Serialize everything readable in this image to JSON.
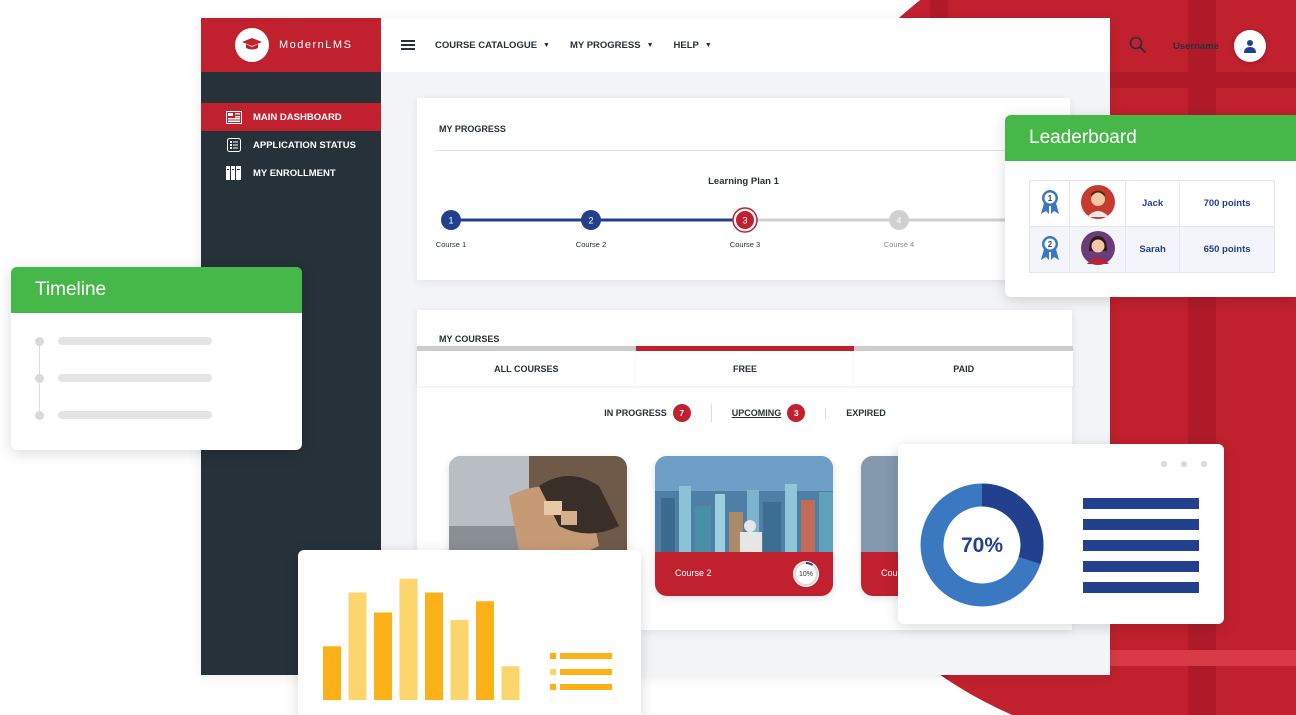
{
  "brand": {
    "name": "ModernLMS"
  },
  "sidebar": {
    "items": [
      {
        "label": "MAIN DASHBOARD",
        "icon": "dashboard-icon",
        "active": true
      },
      {
        "label": "APPLICATION STATUS",
        "icon": "checklist-icon",
        "active": false
      },
      {
        "label": "MY ENROLLMENT",
        "icon": "books-icon",
        "active": false
      }
    ]
  },
  "topbar": {
    "menu": [
      {
        "label": "COURSE CATALOGUE"
      },
      {
        "label": "MY PROGRESS"
      },
      {
        "label": "HELP"
      }
    ],
    "username": "Username"
  },
  "progress": {
    "title": "MY PROGRESS",
    "plan": "Learning Plan 1",
    "steps": [
      {
        "num": "1",
        "label": "Course 1",
        "state": "done"
      },
      {
        "num": "2",
        "label": "Course 2",
        "state": "done"
      },
      {
        "num": "3",
        "label": "Course 3",
        "state": "current"
      },
      {
        "num": "4",
        "label": "Course 4",
        "state": "pending"
      }
    ]
  },
  "courses": {
    "title": "MY COURSES",
    "tabs": [
      {
        "label": "ALL COURSES",
        "active": false
      },
      {
        "label": "FREE",
        "active": true
      },
      {
        "label": "PAID",
        "active": false
      }
    ],
    "filters": [
      {
        "label": "IN PROGRESS",
        "count": "7"
      },
      {
        "label": "UPCOMING",
        "count": "3"
      },
      {
        "label": "EXPIRED",
        "count": ""
      }
    ],
    "cards": [
      {
        "name": "",
        "progress": ""
      },
      {
        "name": "Course 2",
        "progress": "10%"
      },
      {
        "name": "Cou",
        "progress": ""
      }
    ]
  },
  "leaderboard": {
    "title": "Leaderboard",
    "rows": [
      {
        "rank": "1",
        "name": "Jack",
        "points": "700 points"
      },
      {
        "rank": "2",
        "name": "Sarah",
        "points": "650 points"
      }
    ]
  },
  "timeline": {
    "title": "Timeline"
  },
  "donut": {
    "label": "70%",
    "value": 0.7
  },
  "bars": {
    "values": [
      0.43,
      0.86,
      0.7,
      0.97,
      0.86,
      0.64,
      0.79,
      0.27
    ]
  },
  "colors": {
    "brand_red": "#c1202e",
    "sidebar": "#26313a",
    "navy": "#23408f",
    "green": "#46b749",
    "donut_light": "#3b78c2",
    "bar_dark": "#fbb117",
    "bar_light": "#fdd56d"
  }
}
